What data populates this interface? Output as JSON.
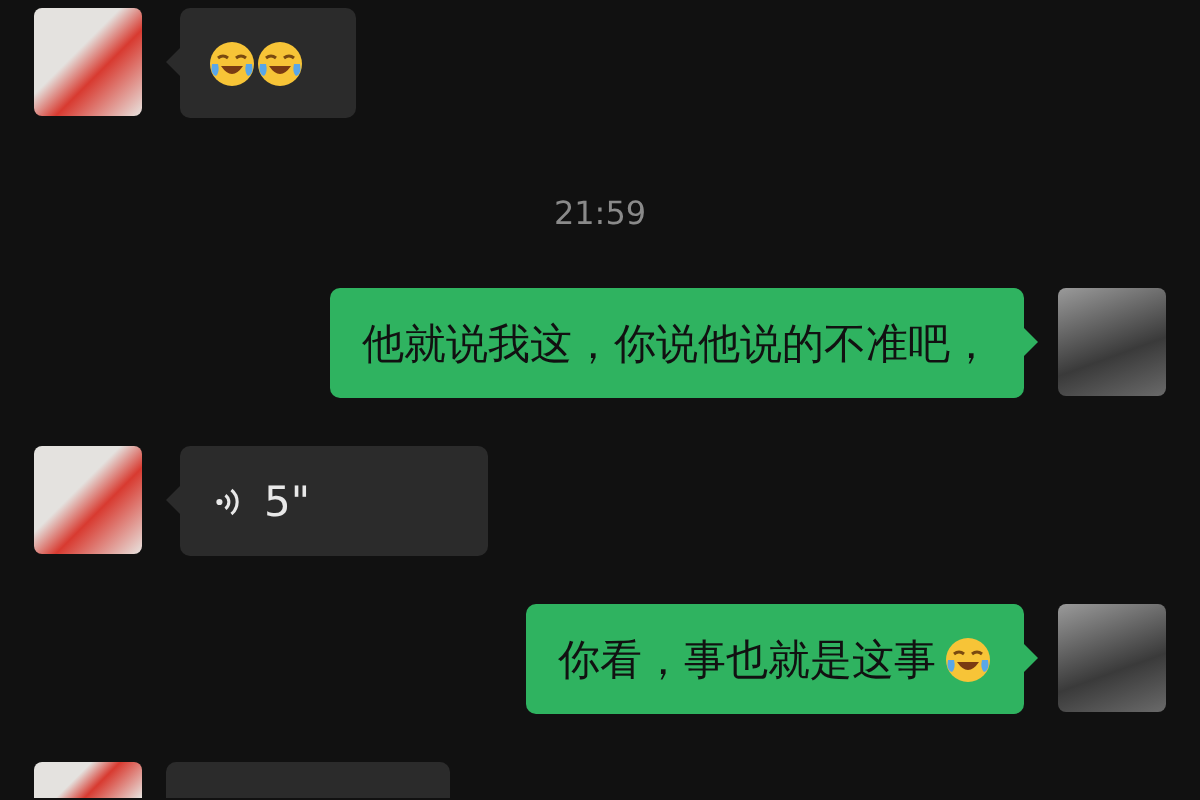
{
  "messages": [
    {
      "kind": "emoji",
      "outgoing": false,
      "emojis": [
        {
          "kind": "tears-of-joy"
        },
        {
          "kind": "tears-of-joy"
        }
      ]
    },
    {
      "kind": "time",
      "text": "21:59"
    },
    {
      "kind": "text",
      "outgoing": true,
      "text": "他就说我这，你说他说的不准吧，"
    },
    {
      "kind": "voice",
      "outgoing": false,
      "text": "5\""
    },
    {
      "kind": "text",
      "outgoing": true,
      "text": "你看，事也就是这事",
      "emojis": [
        {
          "kind": "tears-of-joy"
        }
      ]
    },
    {
      "kind": "clipped",
      "outgoing": false
    }
  ]
}
